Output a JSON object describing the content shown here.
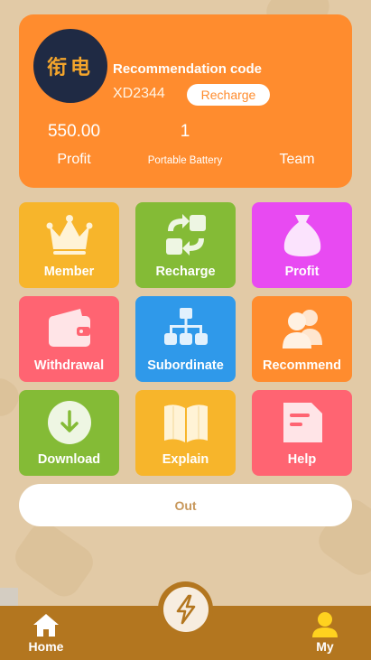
{
  "profile": {
    "logo_text": "衔电",
    "title": "Recommendation code",
    "code": "XD2344",
    "recharge_label": "Recharge",
    "stats": [
      {
        "value": "550.00",
        "label": "Profit"
      },
      {
        "value": "1",
        "label": "Portable Battery"
      },
      {
        "value": "",
        "label": "Team"
      }
    ]
  },
  "tiles": [
    {
      "label": "Member",
      "icon": "crown-icon",
      "color": "#f7b52b"
    },
    {
      "label": "Recharge",
      "icon": "recharge-arrows-icon",
      "color": "#84bb36"
    },
    {
      "label": "Profit",
      "icon": "money-bag-icon",
      "color": "#e84af2"
    },
    {
      "label": "Withdrawal",
      "icon": "wallet-icon",
      "color": "#ff6472"
    },
    {
      "label": "Subordinate",
      "icon": "org-chart-icon",
      "color": "#2f99ea"
    },
    {
      "label": "Recommend",
      "icon": "people-icon",
      "color": "#ff8c2e"
    },
    {
      "label": "Download",
      "icon": "download-icon",
      "color": "#84bb36"
    },
    {
      "label": "Explain",
      "icon": "book-icon",
      "color": "#f7b52b"
    },
    {
      "label": "Help",
      "icon": "document-icon",
      "color": "#ff6472"
    }
  ],
  "out_label": "Out",
  "nav": {
    "home_label": "Home",
    "my_label": "My"
  }
}
